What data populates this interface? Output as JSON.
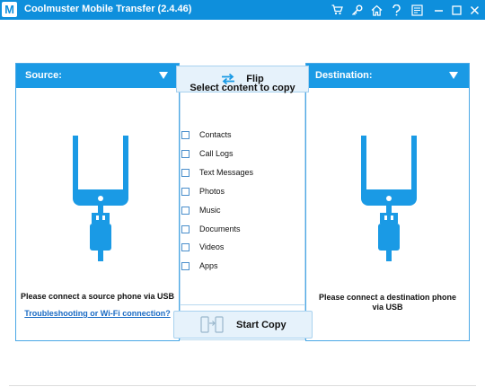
{
  "window": {
    "title": "Coolmuster Mobile Transfer (2.4.46)",
    "logo_letter": "M",
    "controls": [
      "cart-icon",
      "key-icon",
      "home-icon",
      "help-icon",
      "feedback-icon",
      "minimize-icon",
      "maximize-icon",
      "close-icon"
    ]
  },
  "source": {
    "label": "Source:",
    "message": "Please connect a source phone via USB",
    "link": "Troubleshooting or Wi-Fi connection?"
  },
  "destination": {
    "label": "Destination:",
    "message_line1": "Please connect a destination phone",
    "message_line2": "via USB"
  },
  "flip": {
    "label": "Flip"
  },
  "content": {
    "title": "Select content to copy",
    "items": [
      {
        "label": "Contacts",
        "checked": false
      },
      {
        "label": "Call Logs",
        "checked": false
      },
      {
        "label": "Text Messages",
        "checked": false
      },
      {
        "label": "Photos",
        "checked": false
      },
      {
        "label": "Music",
        "checked": false
      },
      {
        "label": "Documents",
        "checked": false
      },
      {
        "label": "Videos",
        "checked": false
      },
      {
        "label": "Apps",
        "checked": false
      }
    ]
  },
  "start_copy": {
    "label": "Start Copy"
  },
  "colors": {
    "accent": "#1a9ae5",
    "titlebar": "#0e8fdc",
    "phone": "#1a9ae5",
    "link": "#1a6bc4"
  }
}
